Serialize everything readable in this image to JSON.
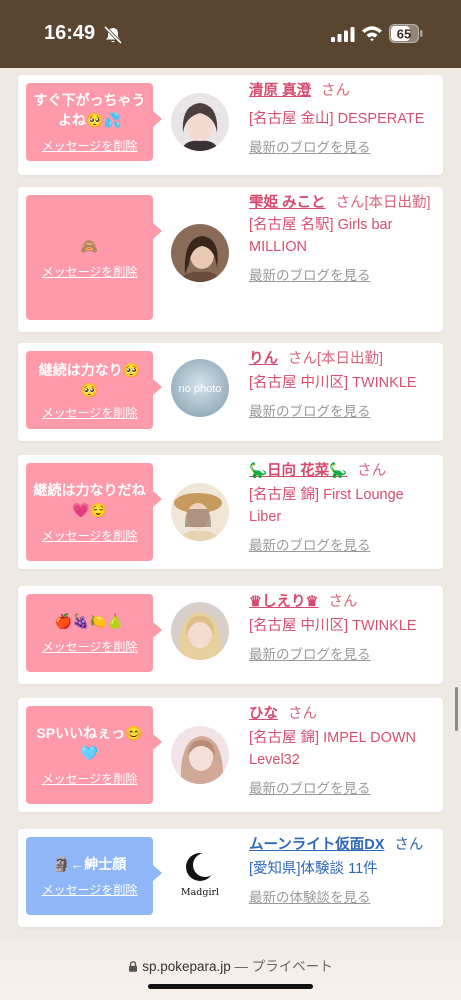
{
  "status_bar": {
    "time": "16:49",
    "battery": "65"
  },
  "cards": [
    {
      "message": "すぐ下がっちゃうよね🥺💦",
      "delete_label": "メッセージを削除",
      "name": "清原 真澄",
      "suffix": "さん",
      "shop": "[名古屋 金山] DESPERATE",
      "link": "最新のブログを見る"
    },
    {
      "message": "🙈",
      "delete_label": "メッセージを削除",
      "name": "雫姫 みこと",
      "suffix": "さん[本日出勤]",
      "shop": "[名古屋 名駅] Girls bar MILLION",
      "link": "最新のブログを見る"
    },
    {
      "message": "継続は力なり🥺🥺",
      "delete_label": "メッセージを削除",
      "name": "りん",
      "suffix": "さん[本日出勤]",
      "shop": "[名古屋 中川区] TWINKLE",
      "link": "最新のブログを見る",
      "avatar_text": "no photo"
    },
    {
      "message": "継続は力なりだね💗😌",
      "delete_label": "メッセージを削除",
      "name": "🦕日向 花菜🦕",
      "suffix": "さん",
      "shop": "[名古屋 錦] First Lounge Liber",
      "link": "最新のブログを見る"
    },
    {
      "message": "🍎🍇🍋🍐",
      "delete_label": "メッセージを削除",
      "name": "♛しえり♛",
      "suffix": "さん",
      "shop": "[名古屋 中川区] TWINKLE",
      "link": "最新のブログを見る"
    },
    {
      "message": "SPいいねぇっ😊🩵",
      "delete_label": "メッセージを削除",
      "name": "ひな",
      "suffix": "さん",
      "shop": "[名古屋 錦] IMPEL DOWN Level32",
      "link": "最新のブログを見る"
    },
    {
      "message": "🗿←紳士顔",
      "delete_label": "メッセージを削除",
      "name": "ムーンライト仮面DX",
      "suffix": "さん",
      "shop": "[愛知県]体験談 11件",
      "link": "最新の体験談を見る",
      "avatar_text": "Madgirl"
    }
  ],
  "address_bar": {
    "domain": "sp.pokepara.jp",
    "separator": "—",
    "mode": "プライベート"
  },
  "colors": {
    "status_bar": "#5a4531",
    "pink_bubble": "#ff9aab",
    "blue_bubble": "#8fb6f7",
    "name_pink": "#d64a6e",
    "name_blue": "#2d67b8"
  }
}
